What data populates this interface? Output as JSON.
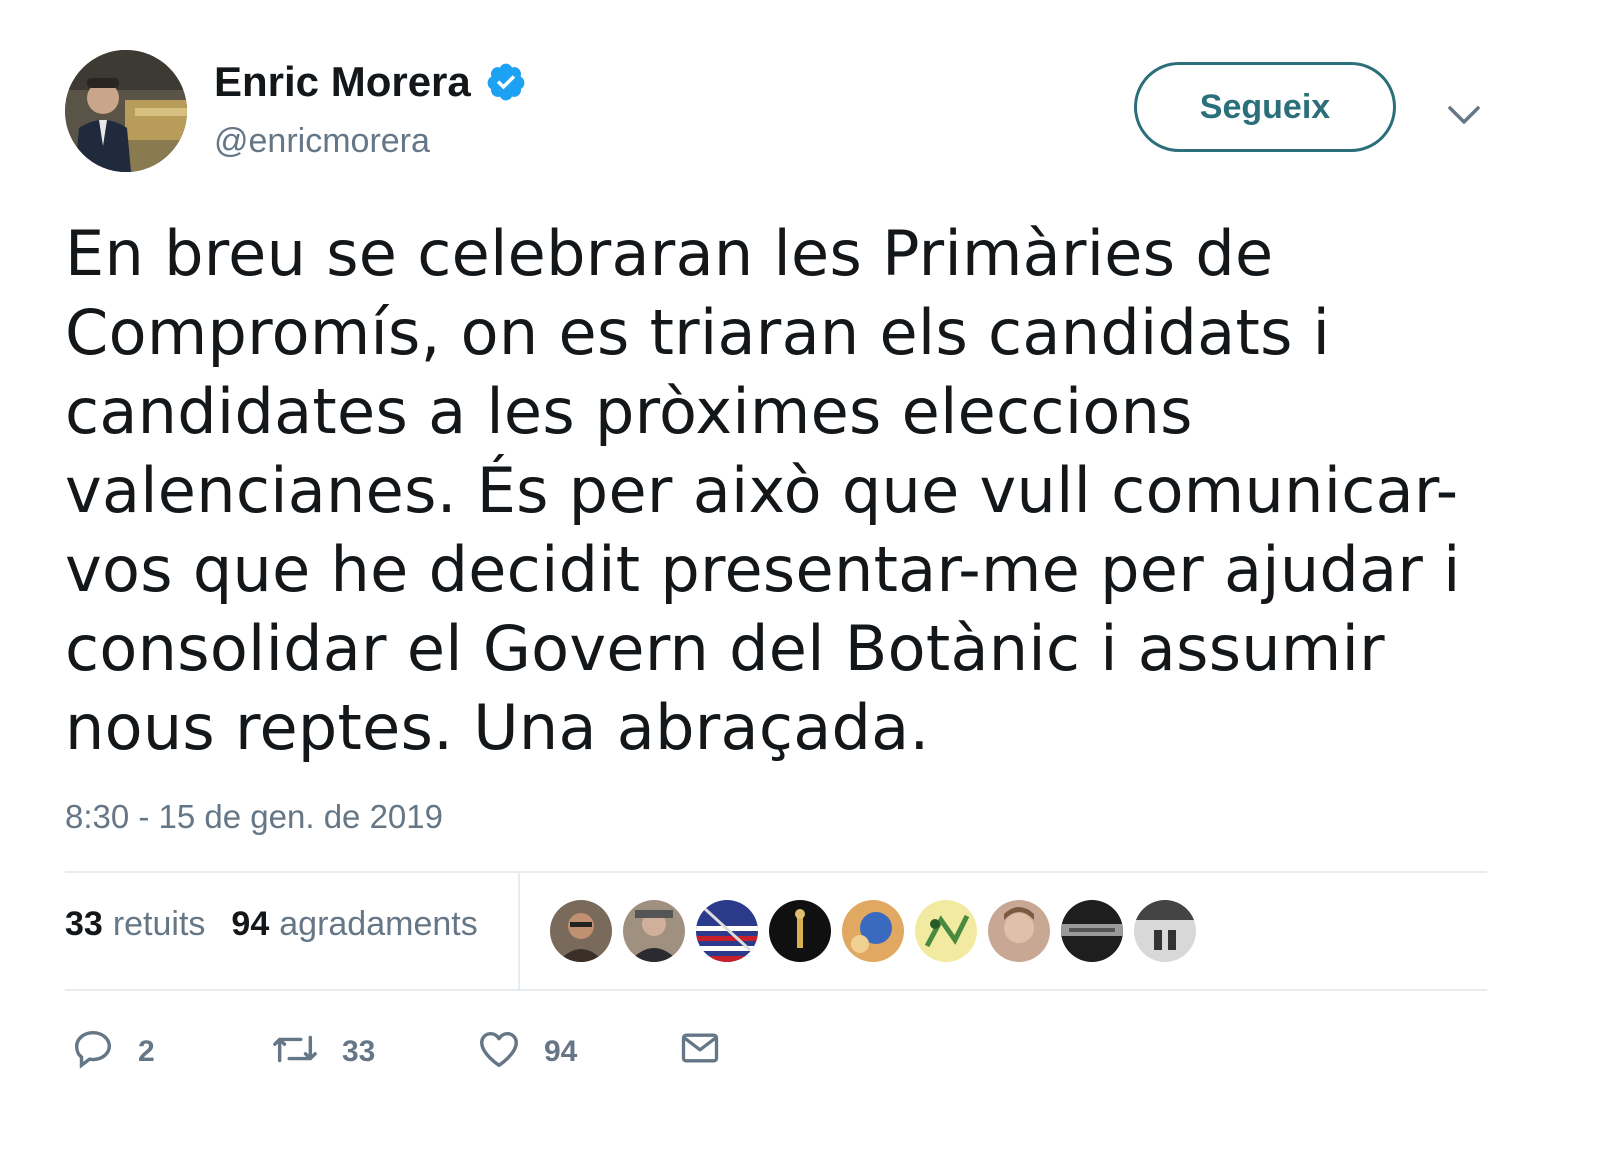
{
  "author": {
    "name": "Enric Morera",
    "handle": "@enricmorera",
    "verified": true,
    "avatar_icon": "avatar-photo"
  },
  "follow_button": {
    "label": "Segueix"
  },
  "menu": {
    "icon": "chevron-down-icon"
  },
  "tweet": {
    "text_lines": [
      "En breu se celebraran les Primàries de",
      "Compromís, on es triaran els candidats i",
      "candidates a les pròximes eleccions",
      "valencianes. És per això que vull comunicar-",
      "vos que he decidit presentar-me per ajudar i",
      "consolidar el Govern del Botànic i assumir",
      "nous reptes. Una abraçada."
    ],
    "timestamp": "8:30 - 15 de gen. de 2019"
  },
  "stats": {
    "retweets": {
      "count": "33",
      "label": "retuits"
    },
    "likes": {
      "count": "94",
      "label": "agradaments"
    }
  },
  "likers": [
    {
      "icon": "liker-avatar-1"
    },
    {
      "icon": "liker-avatar-2"
    },
    {
      "icon": "liker-avatar-3"
    },
    {
      "icon": "liker-avatar-4"
    },
    {
      "icon": "liker-avatar-5"
    },
    {
      "icon": "liker-avatar-6"
    },
    {
      "icon": "liker-avatar-7"
    },
    {
      "icon": "liker-avatar-8"
    },
    {
      "icon": "liker-avatar-9"
    }
  ],
  "actions": {
    "reply": {
      "icon": "reply-icon",
      "count": "2"
    },
    "retweet": {
      "icon": "retweet-icon",
      "count": "33"
    },
    "like": {
      "icon": "heart-icon",
      "count": "94"
    },
    "message": {
      "icon": "envelope-icon"
    }
  },
  "colors": {
    "text": "#14171a",
    "secondary": "#657786",
    "follow": "#2a6f7a",
    "verified": "#1da1f2",
    "divider": "#e6ecf0"
  }
}
